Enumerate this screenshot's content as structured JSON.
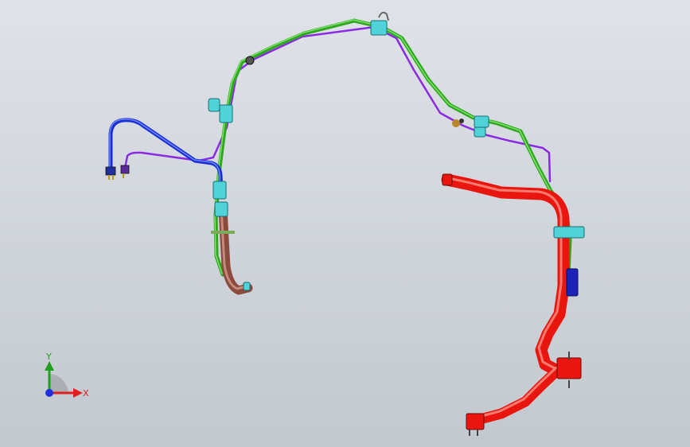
{
  "viewport": {
    "background_top": "#dfe3e8",
    "background_bottom": "#c3c8cf"
  },
  "parts": {
    "green_line": {
      "color": "#2fa81f",
      "highlight": "#7be06a"
    },
    "purple_line": {
      "color": "#8a2be2"
    },
    "blue_line": {
      "color": "#1a2fd6",
      "highlight": "#6f86ff"
    },
    "red_hose": {
      "color": "#e8160e",
      "highlight": "#ff7a6e"
    },
    "brown_hose": {
      "color": "#8c4a3c",
      "highlight": "#c48a7c"
    },
    "clip": {
      "color": "#4fd2d8"
    },
    "connector": {
      "color": "#1d22b8"
    },
    "fitting": {
      "color": "#b8862a"
    }
  },
  "triad": {
    "x_label": "X",
    "y_label": "Y",
    "x_color": "#e02020",
    "y_color": "#20a020",
    "z_color": "#2030e0"
  }
}
